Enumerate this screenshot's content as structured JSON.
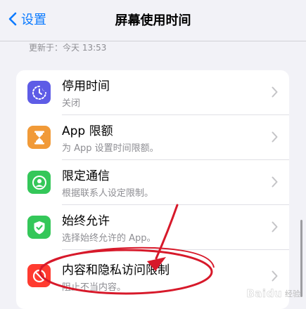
{
  "nav": {
    "back_label": "设置",
    "title": "屏幕使用时间"
  },
  "updated_text": "更新于：今天 13:53",
  "rows": [
    {
      "title": "停用时间",
      "subtitle": "关闭",
      "icon": "moon-hourglass-icon",
      "color": "#5e5ce6"
    },
    {
      "title": "App 限额",
      "subtitle": "为 App 设置时间限额。",
      "icon": "hourglass-icon",
      "color": "#f19a38"
    },
    {
      "title": "限定通信",
      "subtitle": "根据联系人设定限制。",
      "icon": "person-circle-icon",
      "color": "#34c759"
    },
    {
      "title": "始终允许",
      "subtitle": "选择始终允许的 App。",
      "icon": "checkmark-shield-icon",
      "color": "#34c759"
    },
    {
      "title": "内容和隐私访问限制",
      "subtitle": "阻止不当内容。",
      "icon": "restriction-icon",
      "color": "#ff3b30"
    }
  ],
  "annotation": {
    "color": "#d7192a",
    "type": "arrow-and-ellipse"
  },
  "watermark": {
    "brand": "Baidu",
    "text": "经验"
  },
  "colors": {
    "accent": "#0a7aff",
    "background": "#f2f2f7"
  }
}
